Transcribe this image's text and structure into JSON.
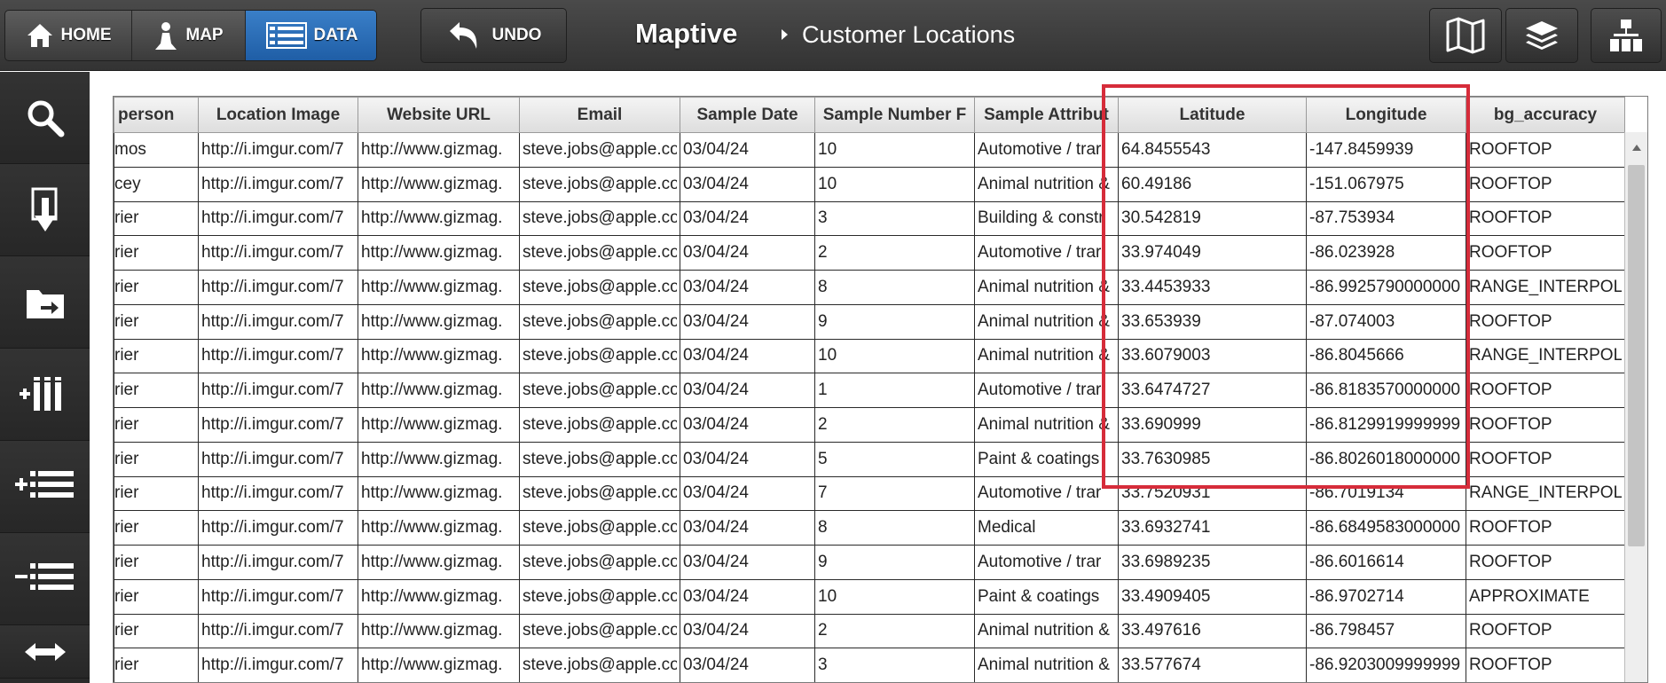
{
  "topbar": {
    "nav": {
      "home": "HOME",
      "map": "MAP",
      "data": "DATA"
    },
    "undo": "UNDO",
    "brand": "Maptive",
    "breadcrumb": "Customer Locations"
  },
  "table": {
    "columns": [
      "person",
      "Location Image",
      "Website URL",
      "Email",
      "Sample Date",
      "Sample Number F",
      "Sample Attribut",
      "Latitude",
      "Longitude",
      "bg_accuracy"
    ],
    "rows": [
      [
        "mos",
        "http://i.imgur.com/7",
        "http://www.gizmag.",
        "steve.jobs@apple.co",
        "03/04/24",
        "10",
        "Automotive / trar",
        "64.8455543",
        "-147.8459939",
        "ROOFTOP"
      ],
      [
        "cey",
        "http://i.imgur.com/7",
        "http://www.gizmag.",
        "steve.jobs@apple.co",
        "03/04/24",
        "10",
        "Animal nutrition &",
        "60.49186",
        "-151.067975",
        "ROOFTOP"
      ],
      [
        "rier",
        "http://i.imgur.com/7",
        "http://www.gizmag.",
        "steve.jobs@apple.co",
        "03/04/24",
        "3",
        "Building & constr",
        "30.542819",
        "-87.753934",
        "ROOFTOP"
      ],
      [
        "rier",
        "http://i.imgur.com/7",
        "http://www.gizmag.",
        "steve.jobs@apple.co",
        "03/04/24",
        "2",
        "Automotive / trar",
        "33.974049",
        "-86.023928",
        "ROOFTOP"
      ],
      [
        "rier",
        "http://i.imgur.com/7",
        "http://www.gizmag.",
        "steve.jobs@apple.co",
        "03/04/24",
        "8",
        "Animal nutrition &",
        "33.4453933",
        "-86.9925790000000",
        "RANGE_INTERPOLAT"
      ],
      [
        "rier",
        "http://i.imgur.com/7",
        "http://www.gizmag.",
        "steve.jobs@apple.co",
        "03/04/24",
        "9",
        "Animal nutrition &",
        "33.653939",
        "-87.074003",
        "ROOFTOP"
      ],
      [
        "rier",
        "http://i.imgur.com/7",
        "http://www.gizmag.",
        "steve.jobs@apple.co",
        "03/04/24",
        "10",
        "Animal nutrition &",
        "33.6079003",
        "-86.8045666",
        "RANGE_INTERPOLAT"
      ],
      [
        "rier",
        "http://i.imgur.com/7",
        "http://www.gizmag.",
        "steve.jobs@apple.co",
        "03/04/24",
        "1",
        "Automotive / trar",
        "33.6474727",
        "-86.8183570000000",
        "ROOFTOP"
      ],
      [
        "rier",
        "http://i.imgur.com/7",
        "http://www.gizmag.",
        "steve.jobs@apple.co",
        "03/04/24",
        "2",
        "Animal nutrition &",
        "33.690999",
        "-86.8129919999999",
        "ROOFTOP"
      ],
      [
        "rier",
        "http://i.imgur.com/7",
        "http://www.gizmag.",
        "steve.jobs@apple.co",
        "03/04/24",
        "5",
        "Paint & coatings",
        "33.7630985",
        "-86.8026018000000",
        "ROOFTOP"
      ],
      [
        "rier",
        "http://i.imgur.com/7",
        "http://www.gizmag.",
        "steve.jobs@apple.co",
        "03/04/24",
        "7",
        "Automotive / trar",
        "33.7520931",
        "-86.7019134",
        "RANGE_INTERPOLAT"
      ],
      [
        "rier",
        "http://i.imgur.com/7",
        "http://www.gizmag.",
        "steve.jobs@apple.co",
        "03/04/24",
        "8",
        "Medical",
        "33.6932741",
        "-86.6849583000000",
        "ROOFTOP"
      ],
      [
        "rier",
        "http://i.imgur.com/7",
        "http://www.gizmag.",
        "steve.jobs@apple.co",
        "03/04/24",
        "9",
        "Automotive / trar",
        "33.6989235",
        "-86.6016614",
        "ROOFTOP"
      ],
      [
        "rier",
        "http://i.imgur.com/7",
        "http://www.gizmag.",
        "steve.jobs@apple.co",
        "03/04/24",
        "10",
        "Paint & coatings",
        "33.4909405",
        "-86.9702714",
        "APPROXIMATE"
      ],
      [
        "rier",
        "http://i.imgur.com/7",
        "http://www.gizmag.",
        "steve.jobs@apple.co",
        "03/04/24",
        "2",
        "Animal nutrition &",
        "33.497616",
        "-86.798457",
        "ROOFTOP"
      ],
      [
        "rier",
        "http://i.imgur.com/7",
        "http://www.gizmag.",
        "steve.jobs@apple.co",
        "03/04/24",
        "3",
        "Animal nutrition &",
        "33.577674",
        "-86.9203009999999",
        "ROOFTOP"
      ]
    ]
  },
  "colors": {
    "active_tab": "#2a6cb8",
    "highlight": "#d62c3a"
  },
  "icons": {
    "nav": [
      "home-icon",
      "map-pin-icon",
      "list-icon"
    ],
    "undo": "undo-arrow-icon",
    "toolbar": [
      "map-icon",
      "layers-icon",
      "hierarchy-icon"
    ],
    "sidebar": [
      "search-icon",
      "import-icon",
      "folder-export-icon",
      "add-column-icon",
      "add-row-icon",
      "remove-row-icon",
      "resize-icon"
    ]
  }
}
